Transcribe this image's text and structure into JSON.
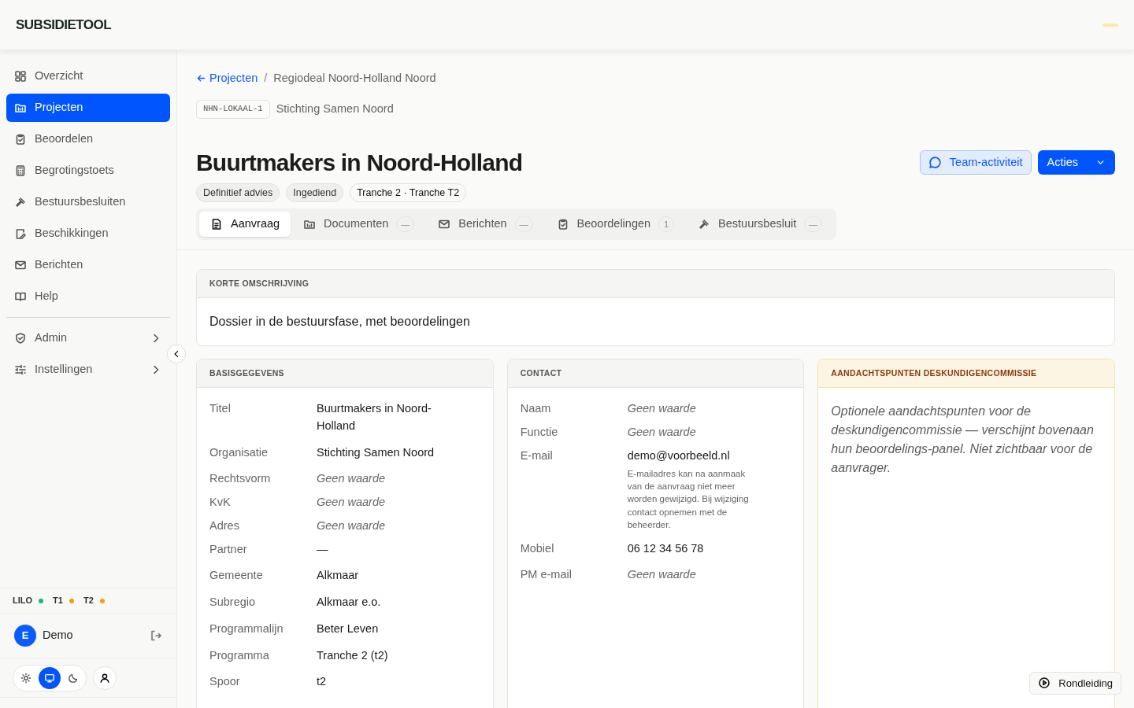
{
  "app": {
    "title": "SUBSIDIETOOL"
  },
  "sidebar": {
    "items": [
      {
        "label": "Overzicht",
        "selected": false
      },
      {
        "label": "Projecten",
        "selected": true
      },
      {
        "label": "Beoordelen",
        "selected": false
      },
      {
        "label": "Begrotingstoets",
        "selected": false
      },
      {
        "label": "Bestuursbesluiten",
        "selected": false
      },
      {
        "label": "Beschikkingen",
        "selected": false
      },
      {
        "label": "Berichten",
        "selected": false
      },
      {
        "label": "Help",
        "selected": false
      }
    ],
    "groups": [
      {
        "label": "Admin",
        "expanded": false
      },
      {
        "label": "Instellingen",
        "expanded": false
      }
    ],
    "environments": [
      {
        "label": "LILO",
        "color": "#10b981"
      },
      {
        "label": "T1",
        "color": "#f59e0b"
      },
      {
        "label": "T2",
        "color": "#f59e0b"
      }
    ],
    "user": {
      "initial": "E",
      "name": "Demo"
    },
    "theme_options": [
      {
        "selected": false
      },
      {
        "selected": true
      },
      {
        "selected": false
      }
    ]
  },
  "breadcrumb": {
    "back": "Projecten",
    "separator": "/",
    "current": "Regiodeal Noord-Holland Noord"
  },
  "project": {
    "code": "NHN-LOKAAL-1",
    "organisation": "Stichting Samen Noord",
    "title": "Buurtmakers in Noord-Holland",
    "badges": [
      {
        "label": "Definitief advies",
        "kind": "muted"
      },
      {
        "label": "Ingediend",
        "kind": "muted"
      },
      {
        "label": "Tranche 2 · Tranche T2",
        "kind": "plain"
      }
    ]
  },
  "actions": {
    "activity": "Team-activiteit",
    "menu": "Acties"
  },
  "tabs": [
    {
      "label": "Aanvraag",
      "selected": true
    },
    {
      "label": "Documenten",
      "selected": false,
      "count": "—"
    },
    {
      "label": "Berichten",
      "selected": false,
      "count": "—"
    },
    {
      "label": "Beoordelingen",
      "selected": false,
      "count": "1"
    },
    {
      "label": "Bestuursbesluit",
      "selected": false,
      "count": "—"
    }
  ],
  "summary": {
    "heading": "KORTE OMSCHRIJVING",
    "text": "Dossier in de bestuursfase, met beoordelingen"
  },
  "basics": {
    "heading": "BASISGEGEVENS",
    "fields": [
      {
        "label": "Titel",
        "value": "Buurtmakers in Noord-Holland",
        "kind": "value"
      },
      {
        "label": "Organisatie",
        "value": "Stichting Samen Noord",
        "kind": "value"
      },
      {
        "label": "Rechtsvorm",
        "value": "Geen waarde",
        "kind": "missing"
      },
      {
        "label": "KvK",
        "value": "Geen waarde",
        "kind": "missing"
      },
      {
        "label": "Adres",
        "value": "Geen waarde",
        "kind": "missing"
      },
      {
        "label": "Partner",
        "value": "—",
        "kind": "value"
      },
      {
        "label": "Gemeente",
        "value": "Alkmaar",
        "kind": "value"
      },
      {
        "label": "Subregio",
        "value": "Alkmaar e.o.",
        "kind": "value"
      },
      {
        "label": "Programmalijn",
        "value": "Beter Leven",
        "kind": "value"
      },
      {
        "label": "Programma",
        "value": "Tranche 2 (t2)",
        "kind": "value"
      },
      {
        "label": "Spoor",
        "value": "t2",
        "kind": "value"
      }
    ]
  },
  "contact": {
    "heading": "CONTACT",
    "fields": [
      {
        "label": "Naam",
        "value": "Geen waarde",
        "kind": "missing"
      },
      {
        "label": "Functie",
        "value": "Geen waarde",
        "kind": "missing"
      },
      {
        "label": "E-mail",
        "value": "demo@voorbeeld.nl",
        "kind": "value",
        "hint": "E-mailadres kan na aanmaak van de aanvraag niet meer worden gewijzigd. Bij wijziging contact opnemen met de beheerder."
      },
      {
        "label": "Mobiel",
        "value": "06 12 34 56 78",
        "kind": "value"
      },
      {
        "label": "PM e-mail",
        "value": "Geen waarde",
        "kind": "missing"
      }
    ]
  },
  "committee": {
    "heading": "AANDACHTSPUNTEN DESKUNDIGENCOMMISSIE",
    "placeholder": "Optionele aandachtspunten voor de deskundigencommissie — verschijnt bovenaan hun beoordelings-panel. Niet zichtbaar voor de aanvrager."
  },
  "tour": {
    "label": "Rondleiding"
  }
}
